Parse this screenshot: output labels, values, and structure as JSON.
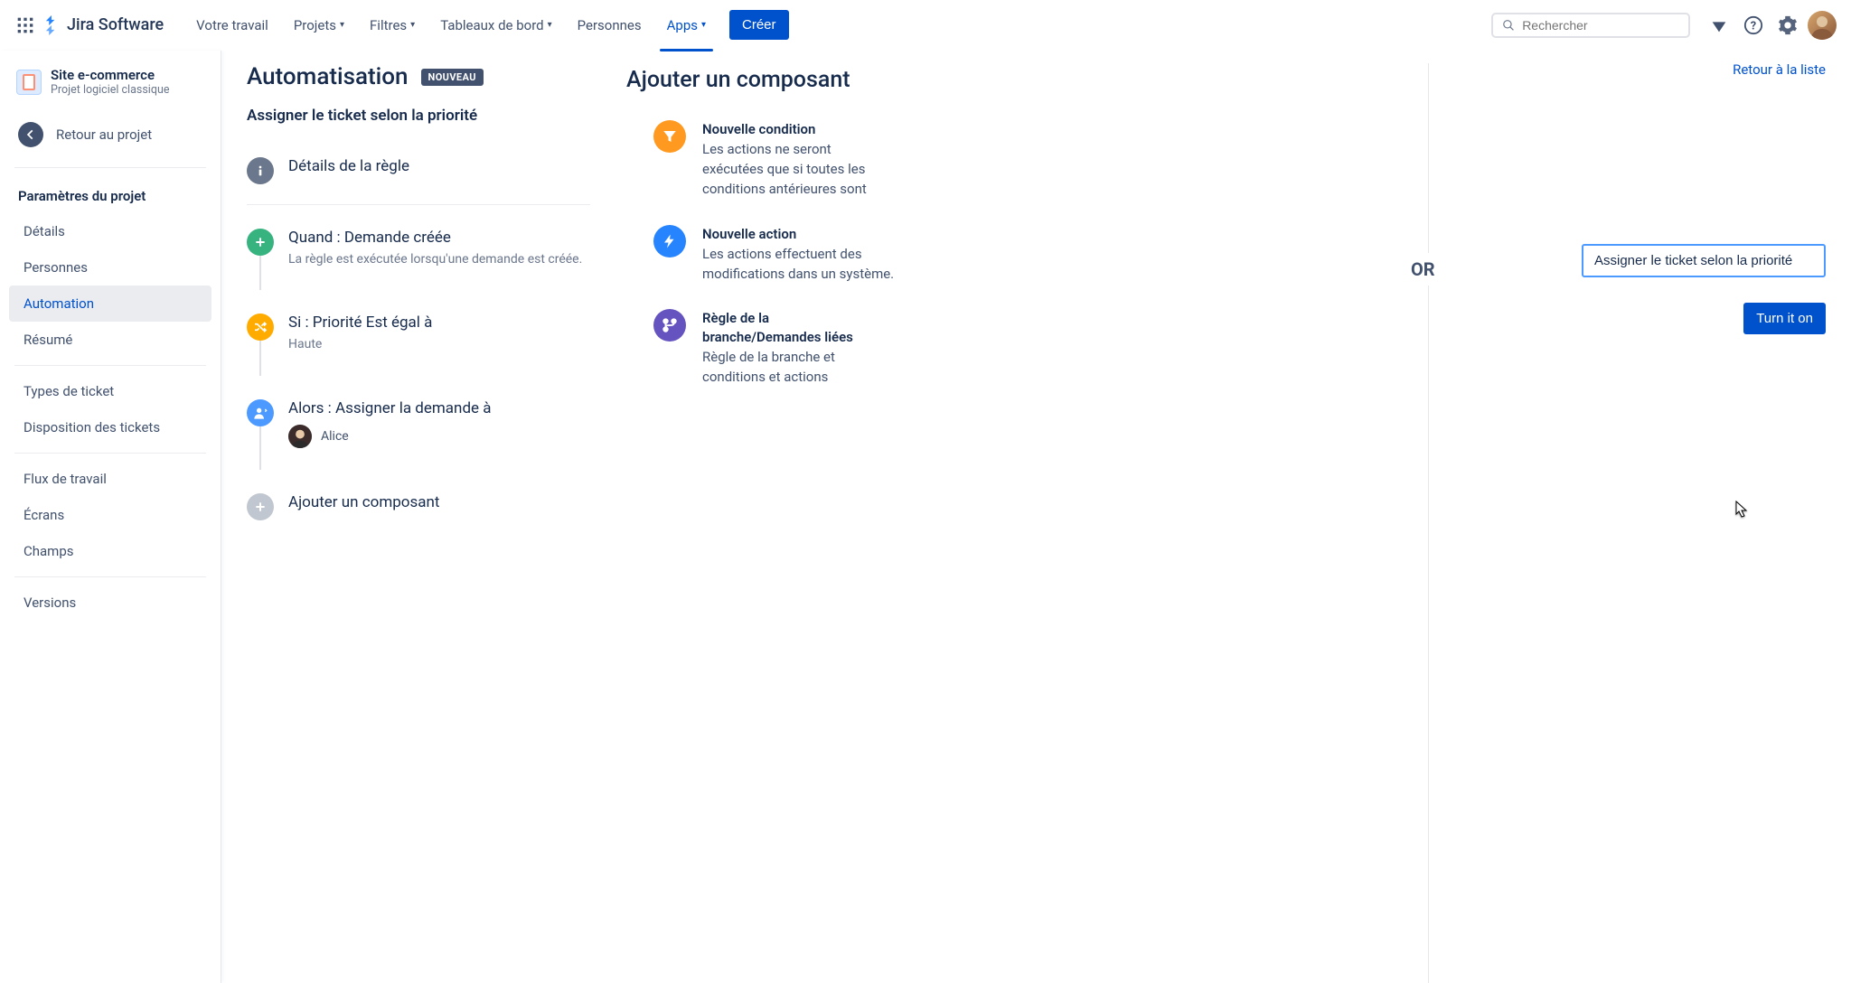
{
  "top": {
    "product": "Jira Software",
    "nav": {
      "work": "Votre travail",
      "projects": "Projets",
      "filters": "Filtres",
      "dashboards": "Tableaux de bord",
      "people": "Personnes",
      "apps": "Apps"
    },
    "create": "Créer",
    "search_placeholder": "Rechercher"
  },
  "sidebar": {
    "project_name": "Site e-commerce",
    "project_type": "Projet logiciel classique",
    "back": "Retour au projet",
    "heading": "Paramètres du projet",
    "items": {
      "details": "Détails",
      "people": "Personnes",
      "automation": "Automation",
      "summary": "Résumé",
      "issuetypes": "Types de ticket",
      "layout": "Disposition des tickets",
      "workflow": "Flux de travail",
      "screens": "Écrans",
      "fields": "Champs",
      "versions": "Versions"
    }
  },
  "rule": {
    "page_title": "Automatisation",
    "lozenge": "NOUVEAU",
    "subtitle": "Assigner le ticket selon la priorité",
    "steps": {
      "details": "Détails de la règle",
      "when_title": "Quand : Demande créée",
      "when_desc": "La règle est exécutée lorsqu'une demande est créée.",
      "if_title": "Si : Priorité Est égal à",
      "if_desc": "Haute",
      "then_title": "Alors : Assigner la demande à",
      "assignee": "Alice",
      "add": "Ajouter un composant"
    }
  },
  "components": {
    "title": "Ajouter un composant",
    "cond_title": "Nouvelle condition",
    "cond_desc": "Les actions ne seront exécutées que si toutes les conditions antérieures sont",
    "action_title": "Nouvelle action",
    "action_desc": "Les actions effectuent des modifications dans un système.",
    "branch_title": "Règle de la branche/Demandes liées",
    "branch_desc": "Règle de la branche et conditions et actions"
  },
  "right": {
    "or": "OR",
    "back_list": "Retour à la liste",
    "rule_name": "Assigner le ticket selon la priorité",
    "turn_on": "Turn it on"
  }
}
